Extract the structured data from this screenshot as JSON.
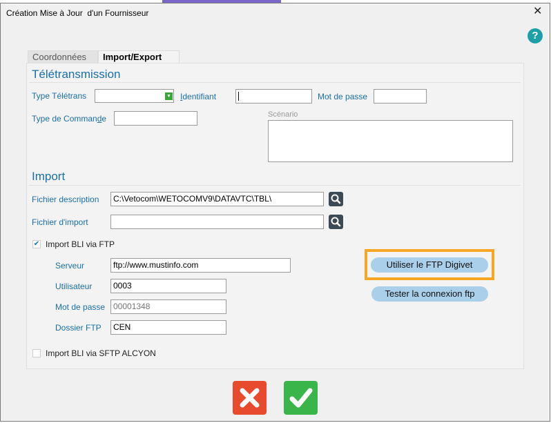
{
  "window": {
    "title": "Création Mise à Jour  d'un Fournisseur"
  },
  "tabs": [
    {
      "label": "Coordonnées"
    },
    {
      "label": "Import/Export"
    }
  ],
  "teletransmission": {
    "section_title": "Télétransmission",
    "type_teletrans_label": "Type Télétrans",
    "type_teletrans_value": "",
    "identifiant_label_prefix": "I",
    "identifiant_label_rest": "dentifiant",
    "identifiant_value": "",
    "mot_de_passe_label": "Mot de passe",
    "mot_de_passe_value": "",
    "type_commande_label_pre": "Type de Comman",
    "type_commande_label_u": "d",
    "type_commande_label_post": "e",
    "type_commande_value": "",
    "scenario_label": "Scénario",
    "scenario_value": ""
  },
  "import": {
    "section_title": "Import",
    "fichier_description_label": "Fichier description",
    "fichier_description_value": "C:\\Vetocom\\WETOCOMV9\\DATAVTC\\TBL\\",
    "fichier_import_label": "Fichier d'import",
    "fichier_import_value": "",
    "bli_ftp_label": "Import BLI via FTP",
    "bli_ftp_checked": true,
    "serveur_label": "Serveur",
    "serveur_value": "ftp://www.mustinfo.com",
    "utilisateur_label": "Utilisateur",
    "utilisateur_value": "0003",
    "mot_de_passe_label": "Mot de passe",
    "mot_de_passe_value": "00001348",
    "dossier_ftp_label": "Dossier FTP",
    "dossier_ftp_value": "CEN",
    "bli_sftp_label": "Import BLI via SFTP ALCYON",
    "bli_sftp_checked": false,
    "ftp_digivet_button": "Utiliser le FTP Digivet",
    "test_ftp_button": "Tester la connexion ftp"
  },
  "icons": {
    "help": "question-icon",
    "close": "close-icon",
    "search": "magnifier-icon",
    "cancel": "x-icon",
    "ok": "checkmark-icon"
  },
  "colors": {
    "accent": "#1a6fa8",
    "cancel": "#e84a2e",
    "ok": "#3ab54a",
    "highlight": "#f5a623",
    "pill": "#a9cfea"
  }
}
